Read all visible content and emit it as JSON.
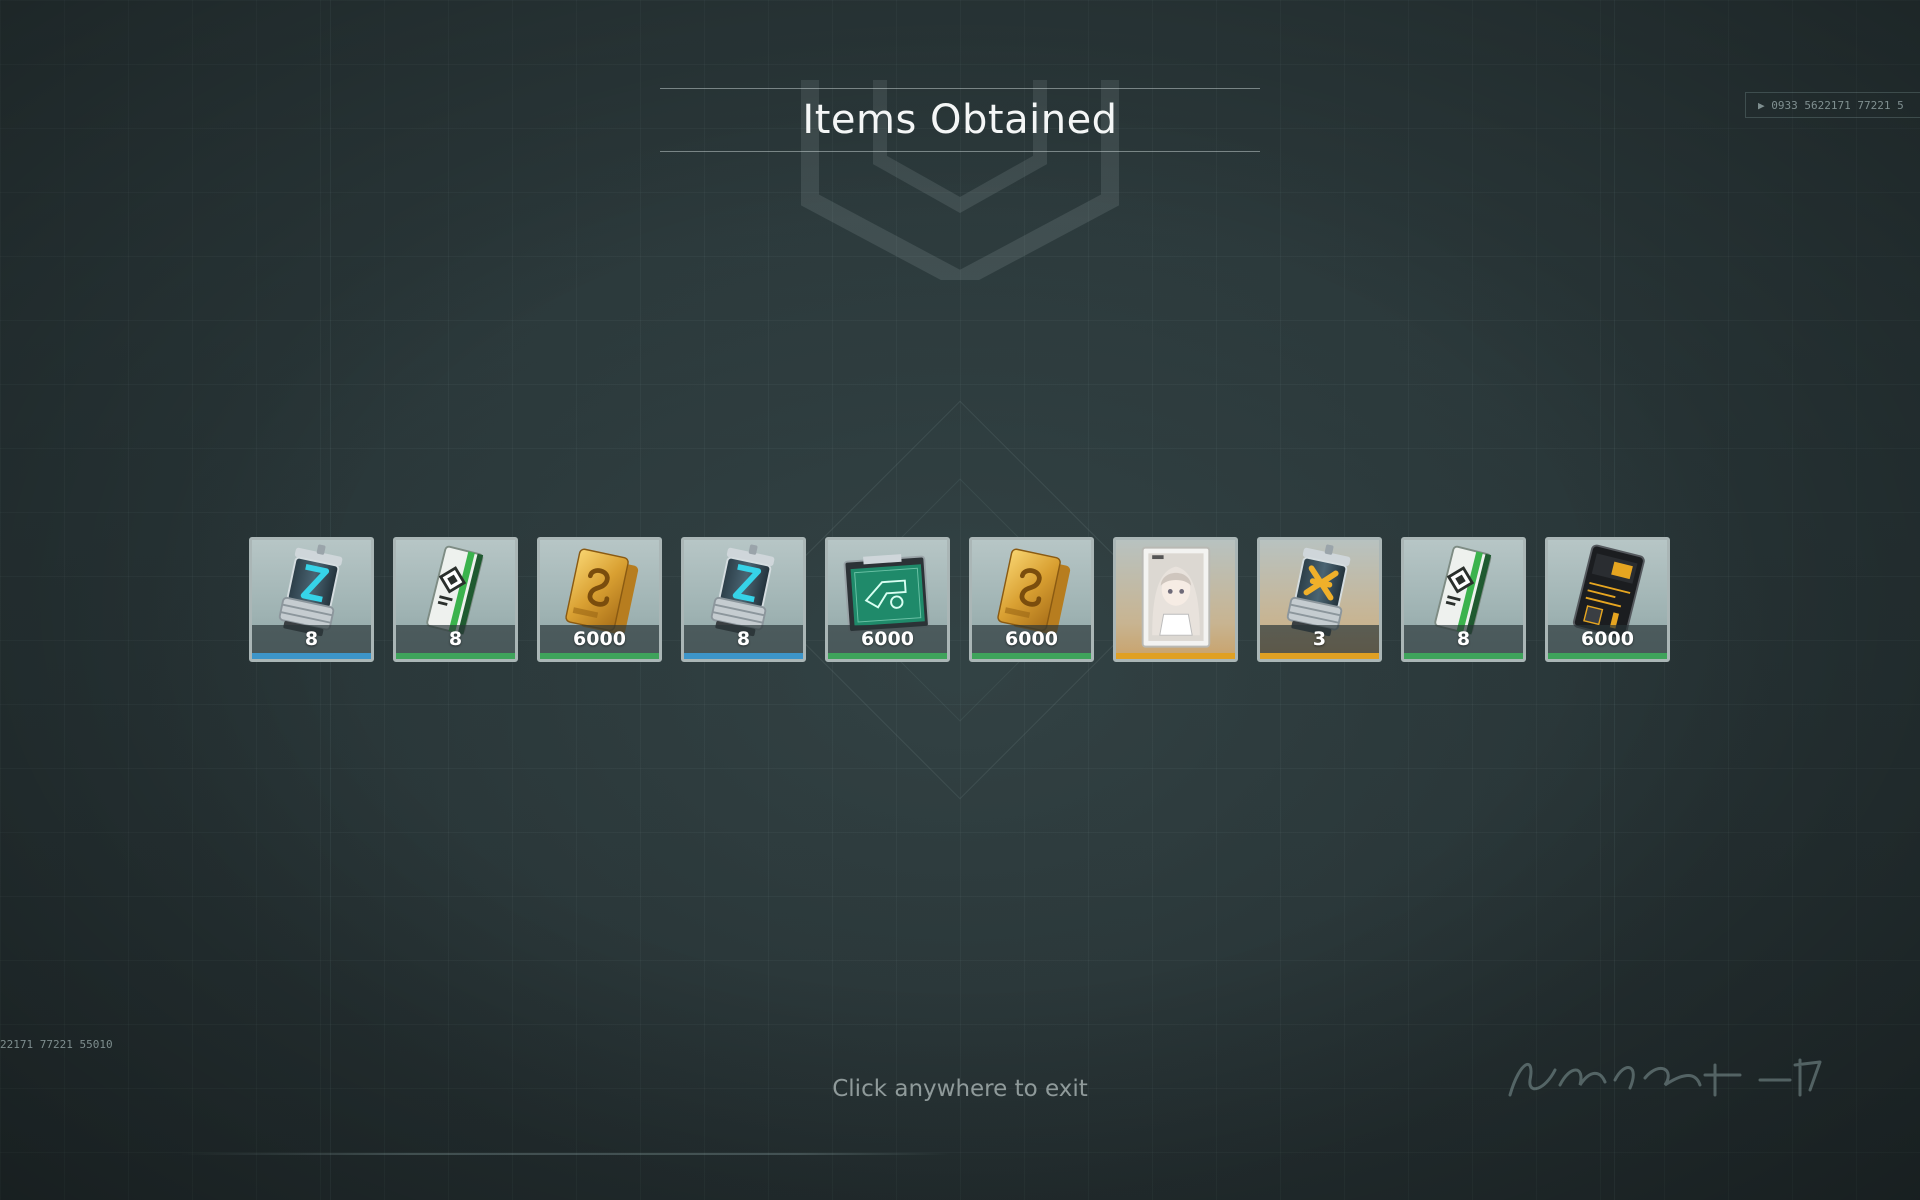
{
  "header": {
    "title": "Items Obtained"
  },
  "decor": {
    "top_right_code": "▶  0933  5622171  77221  5",
    "bottom_left_code": "22171   77221   55010"
  },
  "colors": {
    "rarity_blue": "#3d95c9",
    "rarity_green": "#3fa35b",
    "rarity_gold": "#e0a023"
  },
  "items": [
    {
      "icon": "blue-canister-icon",
      "quantity": "8",
      "rarity": "blue"
    },
    {
      "icon": "green-data-card-icon",
      "quantity": "8",
      "rarity": "green"
    },
    {
      "icon": "gold-credit-bar-icon",
      "quantity": "6000",
      "rarity": "green"
    },
    {
      "icon": "blue-canister-icon",
      "quantity": "8",
      "rarity": "blue"
    },
    {
      "icon": "blueprint-folder-icon",
      "quantity": "6000",
      "rarity": "green"
    },
    {
      "icon": "gold-credit-bar-icon",
      "quantity": "6000",
      "rarity": "green"
    },
    {
      "icon": "character-card-icon",
      "quantity": "",
      "rarity": "gold"
    },
    {
      "icon": "gold-canister-icon",
      "quantity": "3",
      "rarity": "gold"
    },
    {
      "icon": "green-data-card-icon",
      "quantity": "8",
      "rarity": "green"
    },
    {
      "icon": "black-chip-card-icon",
      "quantity": "6000",
      "rarity": "green"
    }
  ],
  "footer": {
    "exit_hint": "Click anywhere to exit"
  }
}
